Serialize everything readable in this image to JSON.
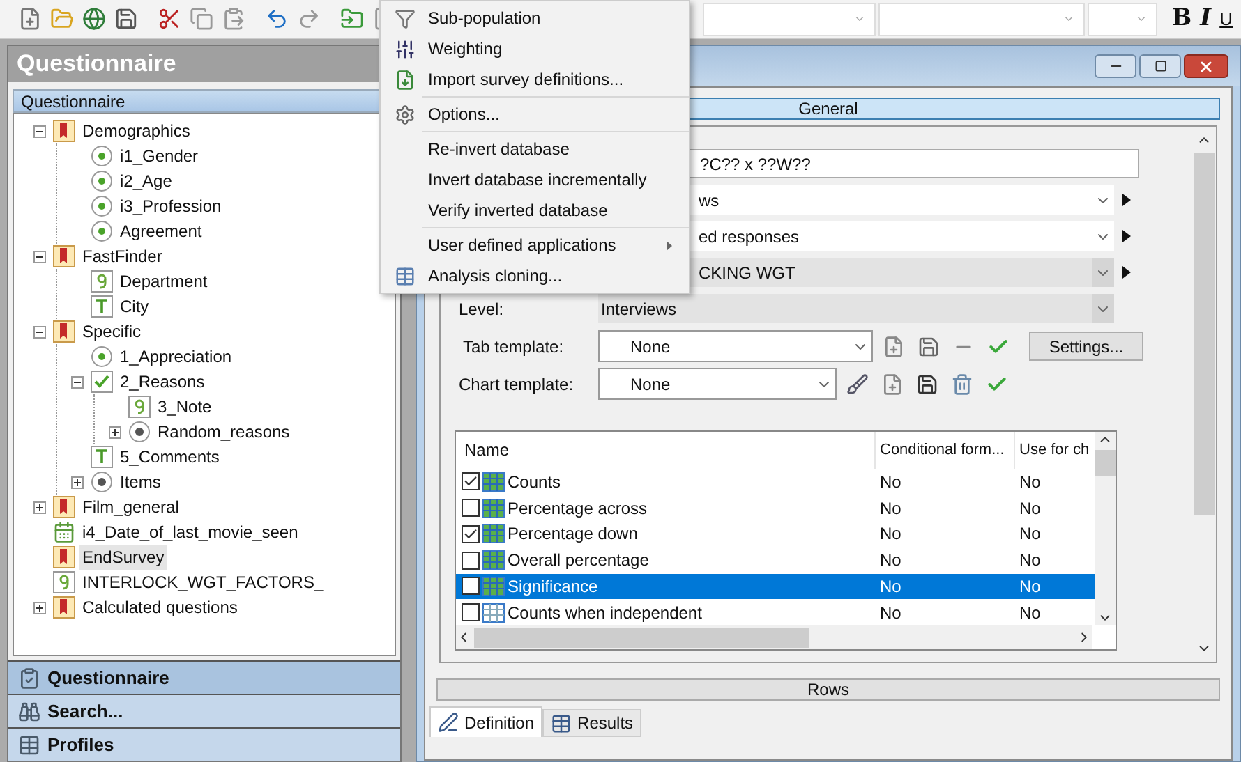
{
  "toolbar": {
    "tools": [
      {
        "kind": "new"
      },
      {
        "kind": "open"
      },
      {
        "kind": "globe"
      },
      {
        "kind": "save"
      },
      {
        "kind": "cut"
      },
      {
        "kind": "copy"
      },
      {
        "kind": "paste"
      },
      {
        "kind": "undo"
      },
      {
        "kind": "redo"
      },
      {
        "kind": "import"
      },
      {
        "kind": "word"
      }
    ],
    "format_buttons": [
      "B",
      "I",
      "U"
    ]
  },
  "menu": {
    "items": [
      {
        "kind": "item",
        "label": "Sub-population",
        "submenu": false
      },
      {
        "kind": "item",
        "label": "Weighting",
        "submenu": false
      },
      {
        "kind": "item",
        "label": "Import survey definitions...",
        "submenu": false
      },
      {
        "kind": "separator"
      },
      {
        "kind": "item",
        "label": "Options...",
        "submenu": false
      },
      {
        "kind": "separator"
      },
      {
        "kind": "item",
        "label": "Re-invert database",
        "submenu": false
      },
      {
        "kind": "item",
        "label": "Invert database incrementally",
        "submenu": false
      },
      {
        "kind": "item",
        "label": "Verify inverted database",
        "submenu": false
      },
      {
        "kind": "separator"
      },
      {
        "kind": "item",
        "label": "User defined applications",
        "submenu": true
      },
      {
        "kind": "item",
        "label": "Analysis cloning...",
        "submenu": false
      }
    ]
  },
  "left_panel": {
    "title": "Questionnaire",
    "tree_header": "Questionnaire",
    "tree": [
      {
        "kind": "section",
        "label": "Demographics",
        "expanded": true,
        "selected": false,
        "children": [
          {
            "kind": "single",
            "label": "i1_Gender",
            "selected": false
          },
          {
            "kind": "single",
            "label": "i2_Age",
            "selected": false
          },
          {
            "kind": "single",
            "label": "i3_Profession",
            "selected": false
          },
          {
            "kind": "single",
            "label": "Agreement",
            "selected": false
          }
        ]
      },
      {
        "kind": "section",
        "label": "FastFinder",
        "expanded": true,
        "selected": false,
        "children": [
          {
            "kind": "numeric",
            "label": "Department",
            "selected": false
          },
          {
            "kind": "text",
            "label": "City",
            "selected": false
          }
        ]
      },
      {
        "kind": "section",
        "label": "Specific",
        "expanded": true,
        "selected": false,
        "children": [
          {
            "kind": "single",
            "label": "1_Appreciation",
            "selected": false
          },
          {
            "kind": "multi",
            "label": "2_Reasons",
            "expanded": true,
            "selected": false,
            "children": [
              {
                "kind": "numeric",
                "label": "3_Note",
                "selected": false
              },
              {
                "kind": "loop",
                "label": "Random_reasons",
                "expanded": false,
                "selected": false
              }
            ]
          },
          {
            "kind": "text",
            "label": "5_Comments",
            "selected": false
          },
          {
            "kind": "loop",
            "label": "Items",
            "expanded": false,
            "selected": false
          }
        ]
      },
      {
        "kind": "section",
        "label": "Film_general",
        "expanded": false,
        "selected": false
      },
      {
        "kind": "date",
        "label": "i4_Date_of_last_movie_seen",
        "selected": false
      },
      {
        "kind": "section",
        "label": "EndSurvey",
        "selected": true
      },
      {
        "kind": "numeric",
        "label": "INTERLOCK_WGT_FACTORS_",
        "selected": false
      },
      {
        "kind": "section",
        "label": "Calculated questions",
        "expanded": false,
        "selected": false
      }
    ],
    "nav": [
      {
        "label": "Questionnaire",
        "selected": true
      },
      {
        "label": "Search...",
        "selected": false
      },
      {
        "label": "Profiles",
        "selected": false
      }
    ]
  },
  "document": {
    "section_header": "General",
    "fields": [
      {
        "kind": "text",
        "value": "?C?? x ??W??"
      },
      {
        "kind": "dropdown",
        "value": "ws",
        "disabled": false,
        "arrow": true
      },
      {
        "kind": "dropdown",
        "value": "ed responses",
        "disabled": false,
        "arrow": true
      },
      {
        "kind": "dropdown",
        "value": "CKING WGT",
        "disabled": true,
        "arrow": true
      },
      {
        "kind": "dropdown",
        "label": "Level:",
        "value": "Interviews",
        "disabled": true,
        "arrow": false
      }
    ],
    "tab_template": {
      "label": "Tab template:",
      "value": "None",
      "settings_button": "Settings..."
    },
    "chart_template": {
      "label": "Chart template:",
      "value": "None"
    },
    "table": {
      "columns": [
        "Name",
        "Conditional form...",
        "Use for ch"
      ],
      "rows": [
        {
          "kind": "colored",
          "name": "Counts",
          "conditional": "No",
          "use_for_chart": "No",
          "checked": true,
          "selected": false
        },
        {
          "kind": "colored",
          "name": "Percentage across",
          "conditional": "No",
          "use_for_chart": "No",
          "checked": false,
          "selected": false
        },
        {
          "kind": "colored",
          "name": "Percentage down",
          "conditional": "No",
          "use_for_chart": "No",
          "checked": true,
          "selected": false
        },
        {
          "kind": "colored",
          "name": "Overall percentage",
          "conditional": "No",
          "use_for_chart": "No",
          "checked": false,
          "selected": false
        },
        {
          "kind": "colored",
          "name": "Significance",
          "conditional": "No",
          "use_for_chart": "No",
          "checked": false,
          "selected": true
        },
        {
          "kind": "plain",
          "name": "Counts when independent",
          "conditional": "No",
          "use_for_chart": "No",
          "checked": false,
          "selected": false
        }
      ]
    },
    "rows_bar": "Rows",
    "tabs": [
      {
        "label": "Definition",
        "selected": true
      },
      {
        "label": "Results",
        "selected": false
      }
    ]
  }
}
